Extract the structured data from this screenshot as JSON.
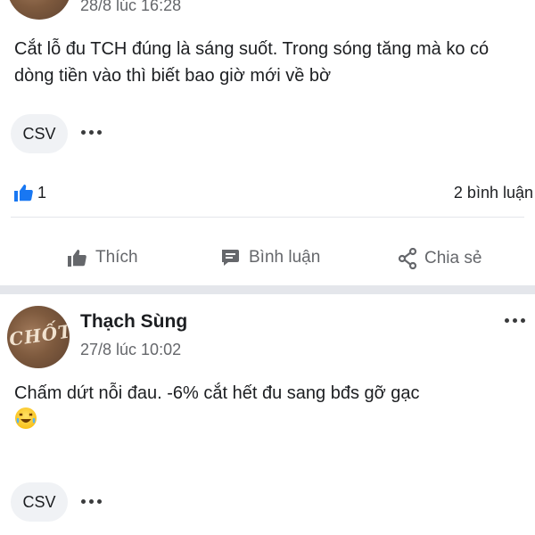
{
  "post1": {
    "timestamp": "28/8 lúc 16:28",
    "text": "Cắt lỗ đu TCH đúng là sáng suốt. Trong sóng tăng mà ko có dòng tiền vào thì biết bao giờ mới về bờ",
    "tag": "CSV",
    "like_count": "1",
    "comment_count": "2 bình luận"
  },
  "actions": {
    "like": "Thích",
    "comment": "Bình luận",
    "share": "Chia sẻ"
  },
  "post2": {
    "author": "Thạch Sùng",
    "timestamp": "27/8 lúc 10:02",
    "avatar_text": "CHỐT",
    "text": "Chấm dứt nỗi đau. -6% cắt hết đu sang bđs gỡ gạc",
    "tag": "CSV"
  },
  "colors": {
    "accent": "#1877f2",
    "muted": "#65676b",
    "divider": "#e4e6eb",
    "pill": "#f0f2f5"
  }
}
